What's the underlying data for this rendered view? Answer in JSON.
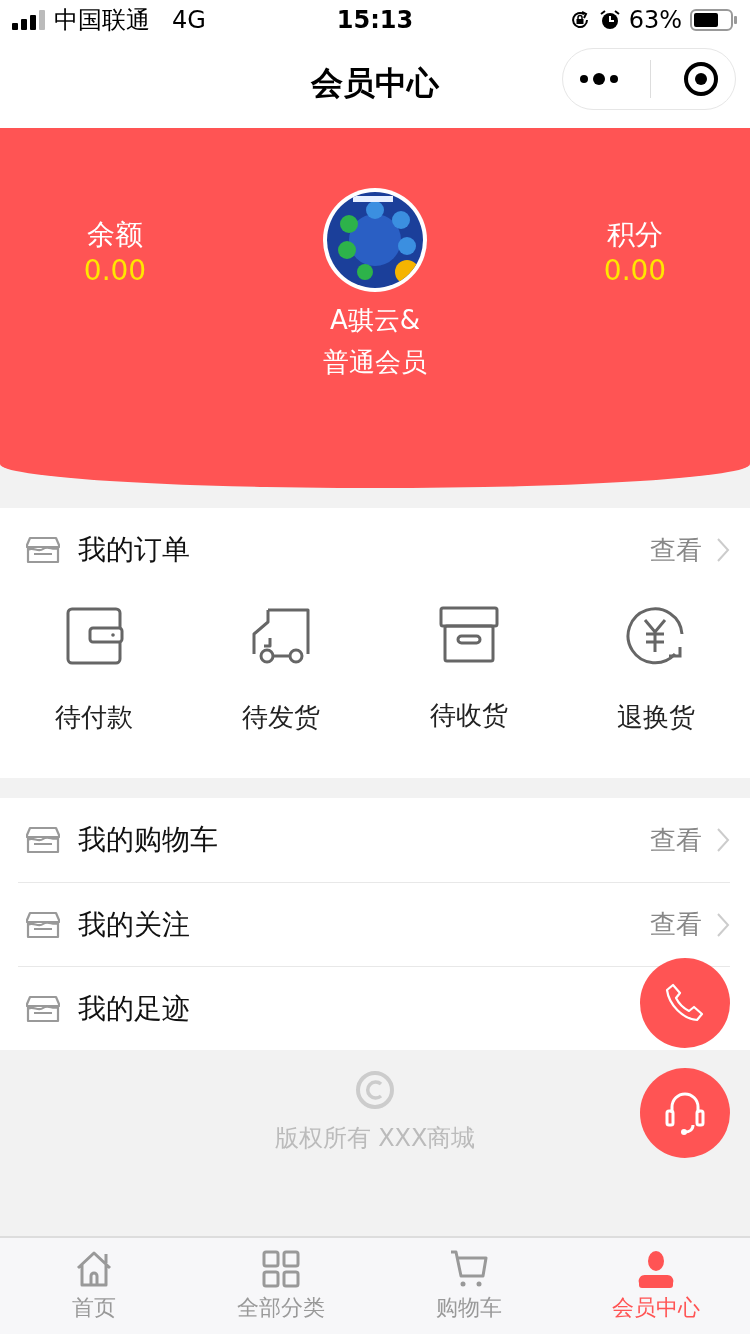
{
  "status_bar": {
    "carrier": "中国联通",
    "network": "4G",
    "time": "15:13",
    "battery": "63%"
  },
  "nav": {
    "title": "会员中心"
  },
  "profile": {
    "balance_label": "余额",
    "balance": "0.00",
    "points_label": "积分",
    "points": "0.00",
    "name": "A骐云&",
    "level": "普通会员"
  },
  "orders": {
    "title": "我的订单",
    "link": "查看",
    "items": [
      {
        "kind": "wallet",
        "label": "待付款"
      },
      {
        "kind": "truck",
        "label": "待发货"
      },
      {
        "kind": "box",
        "label": "待收货"
      },
      {
        "kind": "refund",
        "label": "退换货"
      }
    ]
  },
  "menu": [
    {
      "title": "我的购物车",
      "link": "查看"
    },
    {
      "title": "我的关注",
      "link": "查看"
    },
    {
      "title": "我的足迹"
    }
  ],
  "footer": {
    "copyright": "版权所有 XXX商城"
  },
  "tabs": [
    {
      "kind": "home",
      "label": "首页",
      "selected": false
    },
    {
      "kind": "grid",
      "label": "全部分类",
      "selected": false
    },
    {
      "kind": "cart",
      "label": "购物车",
      "selected": false
    },
    {
      "kind": "user",
      "label": "会员中心",
      "selected": true
    }
  ]
}
